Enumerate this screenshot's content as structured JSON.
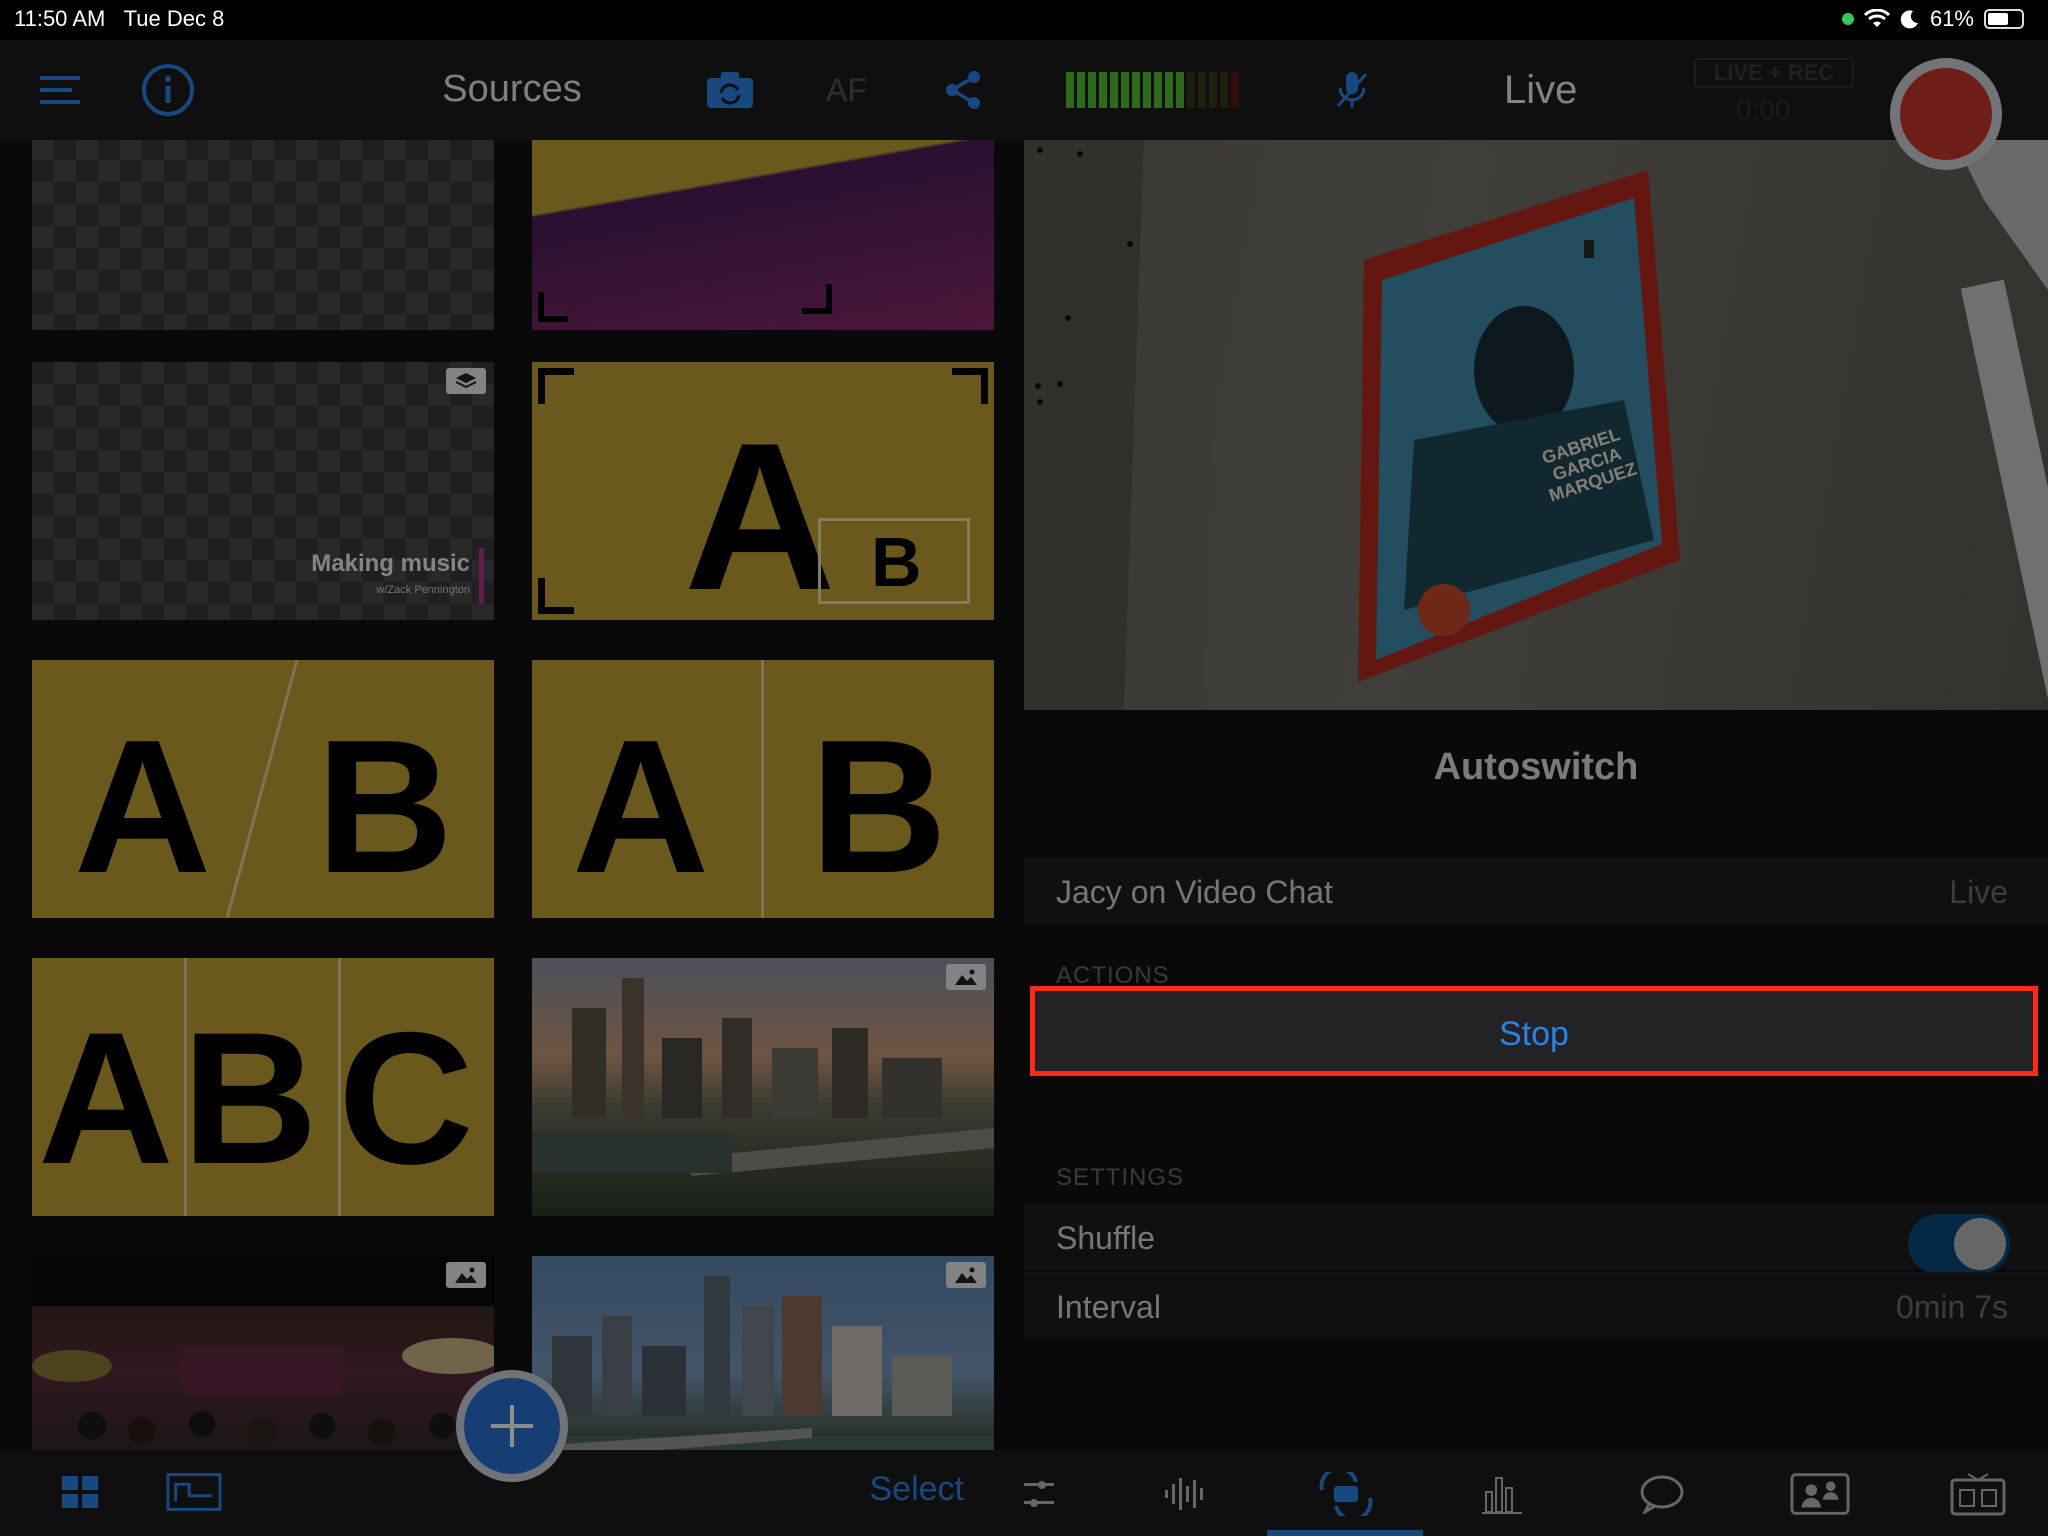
{
  "status": {
    "time": "11:50 AM",
    "date": "Tue Dec 8",
    "battery": "61%",
    "battery_level": 0.61
  },
  "sources": {
    "title": "Sources",
    "af_label": "AF",
    "select_label": "Select",
    "making_music_title": "Making music",
    "making_music_sub": "w/Zack Pennington",
    "letters": {
      "a": "A",
      "b": "B",
      "c": "C"
    }
  },
  "live": {
    "title": "Live",
    "badge": "LIVE + REC",
    "timer": "0:00"
  },
  "autoswitch": {
    "title": "Autoswitch",
    "source_name": "Jacy on Video Chat",
    "source_status": "Live",
    "actions_header": "ACTIONS",
    "stop_label": "Stop",
    "settings_header": "SETTINGS",
    "shuffle_label": "Shuffle",
    "shuffle_on": true,
    "interval_label": "Interval",
    "interval_value": "0min 7s"
  },
  "poster_text": "GABRIEL GARCIA MARQUEZ",
  "colors": {
    "accent": "#2b83e8",
    "highlight": "#ff2a17",
    "record": "#c8382b",
    "tile_yellow": "#c4a136"
  }
}
